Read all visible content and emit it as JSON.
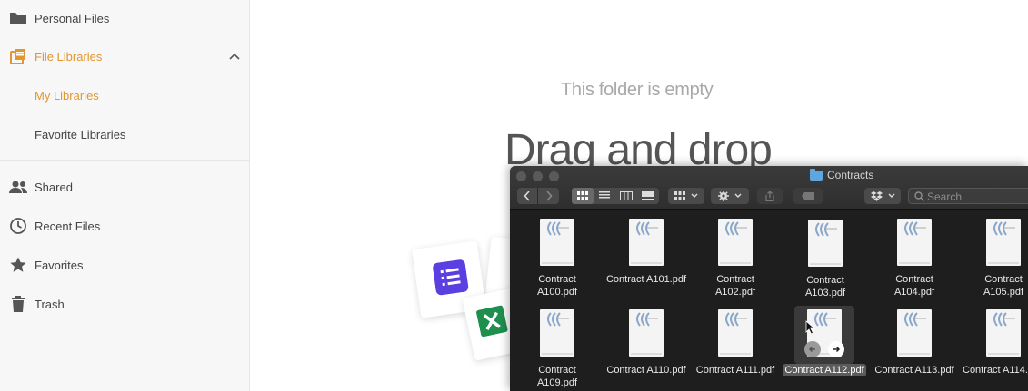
{
  "sidebar": {
    "items": [
      {
        "label": "Personal Files",
        "icon": "folder-icon"
      },
      {
        "label": "File Libraries",
        "icon": "library-icon"
      },
      {
        "label": "My Libraries"
      },
      {
        "label": "Favorite Libraries"
      },
      {
        "label": "Shared",
        "icon": "people-icon"
      },
      {
        "label": "Recent Files",
        "icon": "clock-icon"
      },
      {
        "label": "Favorites",
        "icon": "star-icon"
      },
      {
        "label": "Trash",
        "icon": "trash-icon"
      }
    ]
  },
  "main": {
    "empty_message": "This folder is empty",
    "drag_text": "Drag and drop"
  },
  "finder": {
    "title": "Contracts",
    "search_placeholder": "Search",
    "files": [
      [
        "Contract",
        "A100.pdf"
      ],
      [
        "Contract A101.pdf"
      ],
      [
        "Contract",
        "A102.pdf"
      ],
      [
        "Contract",
        "A103.pdf"
      ],
      [
        "Contract",
        "A104.pdf"
      ],
      [
        "Contract",
        "A105.pdf"
      ],
      [
        "Contract",
        "A109.pdf"
      ],
      [
        "Contract A110.pdf"
      ],
      [
        "Contract A111.pdf"
      ],
      [
        "Contract A112.pdf"
      ],
      [
        "Contract A113.pdf"
      ],
      [
        "Contract A114."
      ]
    ]
  },
  "colors": {
    "accent": "#e1962e",
    "finder_bg": "#1e1e1e"
  }
}
